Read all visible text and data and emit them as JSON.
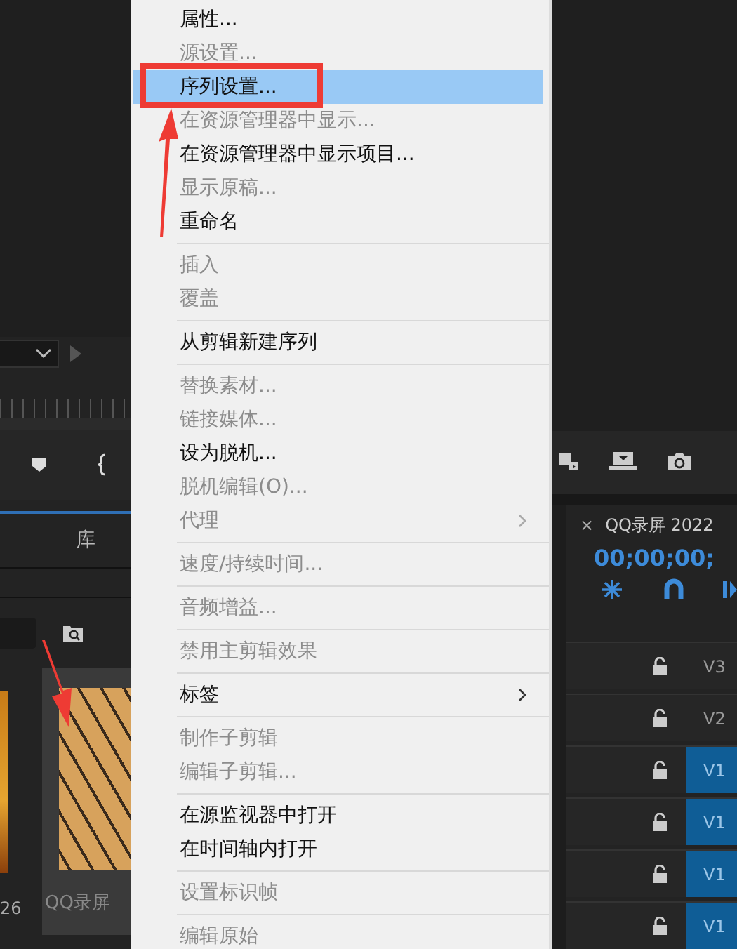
{
  "menu": {
    "items": [
      {
        "kind": "item",
        "label": "属性...",
        "enabled": true,
        "selected": false,
        "submenu": false
      },
      {
        "kind": "item",
        "label": "源设置...",
        "enabled": false,
        "selected": false,
        "submenu": false
      },
      {
        "kind": "item",
        "label": "序列设置...",
        "enabled": true,
        "selected": true,
        "submenu": false
      },
      {
        "kind": "item",
        "label": "在资源管理器中显示...",
        "enabled": false,
        "selected": false,
        "submenu": false
      },
      {
        "kind": "item",
        "label": "在资源管理器中显示项目...",
        "enabled": true,
        "selected": false,
        "submenu": false
      },
      {
        "kind": "item",
        "label": "显示原稿...",
        "enabled": false,
        "selected": false,
        "submenu": false
      },
      {
        "kind": "item",
        "label": "重命名",
        "enabled": true,
        "selected": false,
        "submenu": false
      },
      {
        "kind": "separator"
      },
      {
        "kind": "item",
        "label": "插入",
        "enabled": false,
        "selected": false,
        "submenu": false
      },
      {
        "kind": "item",
        "label": "覆盖",
        "enabled": false,
        "selected": false,
        "submenu": false
      },
      {
        "kind": "separator"
      },
      {
        "kind": "item",
        "label": "从剪辑新建序列",
        "enabled": true,
        "selected": false,
        "submenu": false
      },
      {
        "kind": "separator"
      },
      {
        "kind": "item",
        "label": "替换素材...",
        "enabled": false,
        "selected": false,
        "submenu": false
      },
      {
        "kind": "item",
        "label": "链接媒体...",
        "enabled": false,
        "selected": false,
        "submenu": false
      },
      {
        "kind": "item",
        "label": "设为脱机...",
        "enabled": true,
        "selected": false,
        "submenu": false
      },
      {
        "kind": "item",
        "label": "脱机编辑(O)...",
        "enabled": false,
        "selected": false,
        "submenu": false
      },
      {
        "kind": "item",
        "label": "代理",
        "enabled": false,
        "selected": false,
        "submenu": true
      },
      {
        "kind": "separator"
      },
      {
        "kind": "item",
        "label": "速度/持续时间...",
        "enabled": false,
        "selected": false,
        "submenu": false
      },
      {
        "kind": "separator"
      },
      {
        "kind": "item",
        "label": "音频增益...",
        "enabled": false,
        "selected": false,
        "submenu": false
      },
      {
        "kind": "separator"
      },
      {
        "kind": "item",
        "label": "禁用主剪辑效果",
        "enabled": false,
        "selected": false,
        "submenu": false
      },
      {
        "kind": "separator"
      },
      {
        "kind": "item",
        "label": "标签",
        "enabled": true,
        "selected": false,
        "submenu": true
      },
      {
        "kind": "separator"
      },
      {
        "kind": "item",
        "label": "制作子剪辑",
        "enabled": false,
        "selected": false,
        "submenu": false
      },
      {
        "kind": "item",
        "label": "编辑子剪辑...",
        "enabled": false,
        "selected": false,
        "submenu": false
      },
      {
        "kind": "separator"
      },
      {
        "kind": "item",
        "label": "在源监视器中打开",
        "enabled": true,
        "selected": false,
        "submenu": false
      },
      {
        "kind": "item",
        "label": "在时间轴内打开",
        "enabled": true,
        "selected": false,
        "submenu": false
      },
      {
        "kind": "separator"
      },
      {
        "kind": "item",
        "label": "设置标识帧",
        "enabled": false,
        "selected": false,
        "submenu": false
      },
      {
        "kind": "separator"
      },
      {
        "kind": "item",
        "label": "编辑原始",
        "enabled": false,
        "selected": false,
        "submenu": false
      }
    ]
  },
  "project_panel": {
    "tab": "库",
    "thumbnails": [
      {
        "caption": "26"
      },
      {
        "caption": "QQ录屏"
      }
    ]
  },
  "timeline": {
    "close": "×",
    "title": "QQ录屏 2022",
    "timecode": "00;00;00;",
    "tracks": [
      {
        "label": "V3",
        "targeted": false
      },
      {
        "label": "V2",
        "targeted": false
      },
      {
        "label": "V1",
        "targeted": true
      },
      {
        "label": "V1",
        "targeted": true
      },
      {
        "label": "V1",
        "targeted": true
      },
      {
        "label": "V1",
        "targeted": true
      }
    ]
  }
}
